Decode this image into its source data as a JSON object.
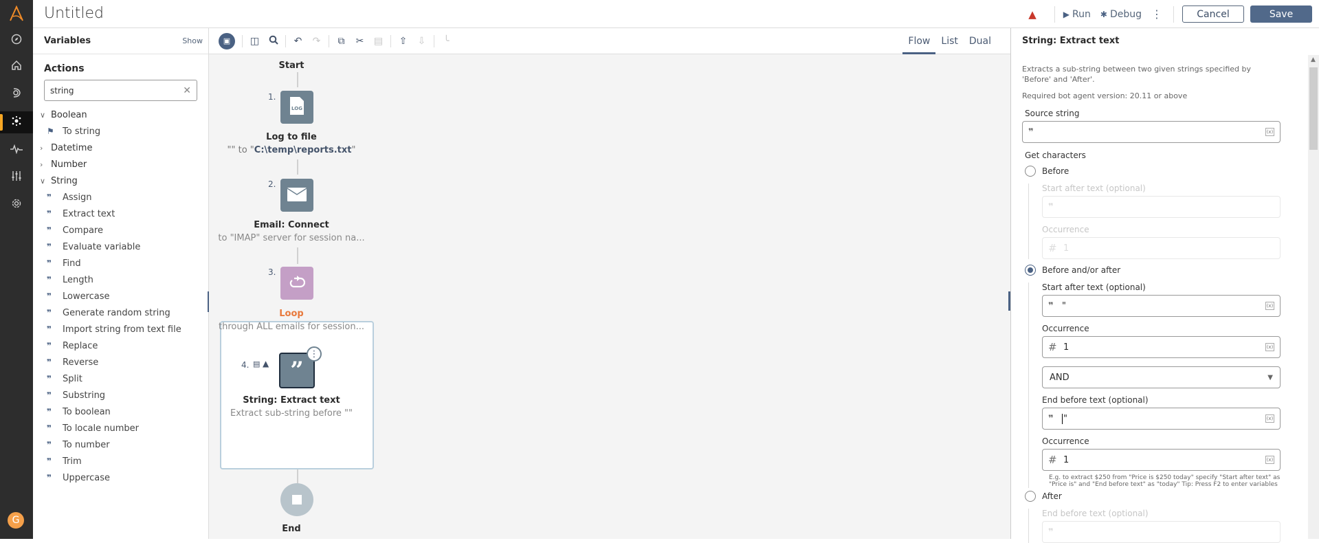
{
  "app": {
    "title": "Untitled"
  },
  "nav": {
    "items": [
      {
        "name": "explore",
        "icon": "compass-icon"
      },
      {
        "name": "home",
        "icon": "home-icon"
      },
      {
        "name": "automation",
        "icon": "bot-icon"
      },
      {
        "name": "bot-editor",
        "icon": "nodes-icon",
        "active": true
      },
      {
        "name": "activity",
        "icon": "pulse-icon"
      },
      {
        "name": "manage",
        "icon": "sliders-icon"
      },
      {
        "name": "administration",
        "icon": "gear-icon"
      }
    ],
    "avatar": "G"
  },
  "toolbar": {
    "run_label": "Run",
    "debug_label": "Debug",
    "cancel_label": "Cancel",
    "save_label": "Save"
  },
  "actions_panel": {
    "variables_label": "Variables",
    "show_label": "Show",
    "actions_label": "Actions",
    "search_value": "string",
    "categories": [
      {
        "label": "Boolean",
        "expanded": true,
        "items": [
          "To string"
        ]
      },
      {
        "label": "Datetime",
        "expanded": false,
        "items": []
      },
      {
        "label": "Number",
        "expanded": false,
        "items": []
      },
      {
        "label": "String",
        "expanded": true,
        "items": [
          "Assign",
          "Extract text",
          "Compare",
          "Evaluate variable",
          "Find",
          "Length",
          "Lowercase",
          "Generate random string",
          "Import string from text file",
          "Replace",
          "Reverse",
          "Split",
          "Substring",
          "To boolean",
          "To locale number",
          "To number",
          "Trim",
          "Uppercase"
        ]
      }
    ]
  },
  "canvas": {
    "view_tabs": [
      "Flow",
      "List",
      "Dual"
    ],
    "active_view": "Flow",
    "start_label": "Start",
    "end_label": "End",
    "nodes": [
      {
        "num": "1.",
        "title": "Log to file",
        "desc_pre": "\"\" to \"",
        "desc_path": "C:\\temp\\reports.txt",
        "desc_post": "\""
      },
      {
        "num": "2.",
        "title": "Email: Connect",
        "desc": "to \"IMAP\" server for session na..."
      },
      {
        "num": "3.",
        "title": "Loop",
        "desc": "through ALL emails for session..."
      },
      {
        "num": "4.",
        "title": "String: Extract text",
        "desc": "Extract sub-string before \"\""
      }
    ]
  },
  "properties": {
    "title": "String: Extract text",
    "description": "Extracts a sub-string between two given strings specified by 'Before' and 'After'.",
    "required_version": "Required bot agent version: 20.11 or above",
    "source_string_label": "Source string",
    "source_string_value": "",
    "get_characters_label": "Get characters",
    "options": [
      {
        "label": "Before",
        "selected": false
      },
      {
        "label": "Before and/or after",
        "selected": true
      },
      {
        "label": "After",
        "selected": false
      }
    ],
    "before_group": {
      "start_after_label": "Start after text (optional)",
      "occurrence_label": "Occurrence",
      "occurrence_value": "1"
    },
    "before_after_group": {
      "start_after_label": "Start after text (optional)",
      "start_after_value": "\"",
      "occurrence_label": "Occurrence",
      "occurrence_value": "1",
      "operator_value": "AND",
      "end_before_label": "End before text (optional)",
      "end_before_value": "\"",
      "occurrence2_label": "Occurrence",
      "occurrence2_value": "1",
      "hint": "E.g. to extract $250 from \"Price is $250 today\" specify \"Start after text\" as \"Price is\" and \"End before text\" as \"today\" Tip: Press F2 to enter variables"
    },
    "after_group": {
      "end_before_label": "End before text (optional)"
    }
  },
  "colors": {
    "accent": "#4a6183",
    "warning": "#c8382b",
    "loop": "#c49fc6",
    "loop_title": "#e8793c",
    "nav_bg": "#2d2d2d",
    "avatar": "#f5a04a"
  }
}
